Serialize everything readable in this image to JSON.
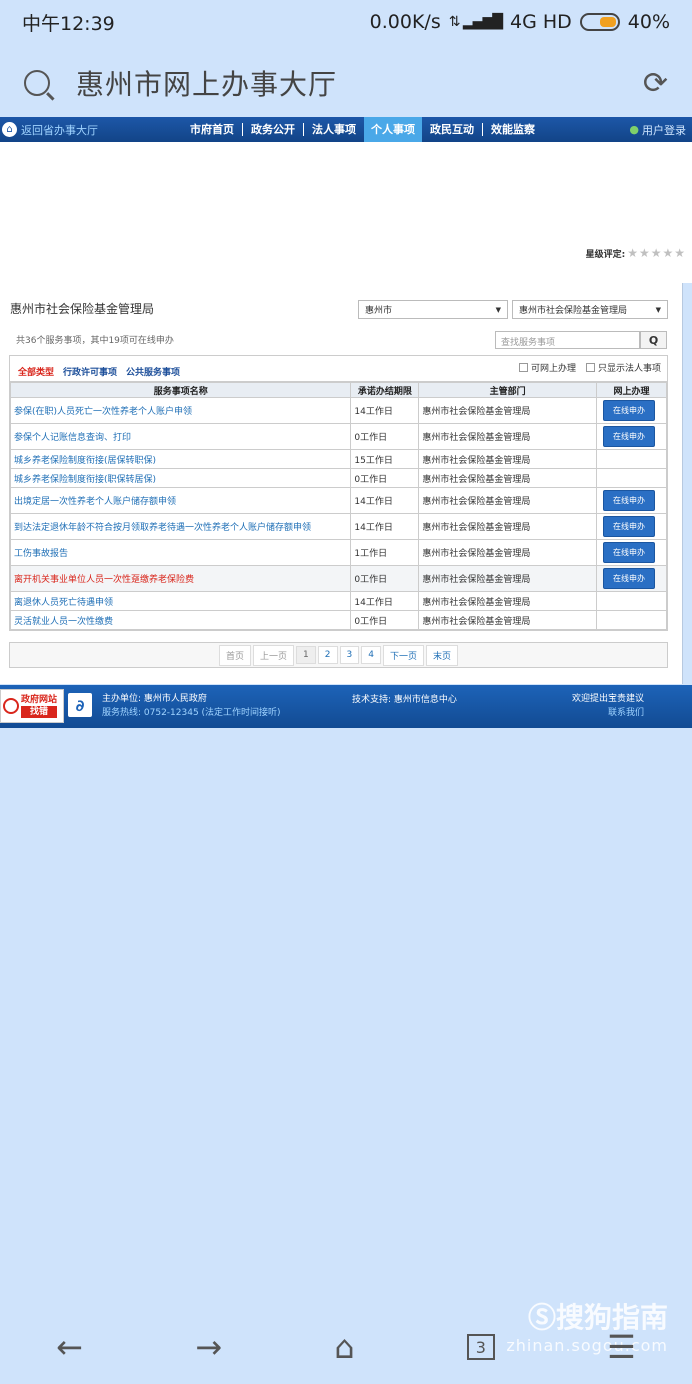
{
  "status": {
    "time": "中午12:39",
    "speed": "0.00K/s",
    "network": "4G HD",
    "battery": "40%"
  },
  "browser": {
    "title": "惠州市网上办事大厅"
  },
  "sitenav": {
    "back": "返回省办事大厅",
    "items": [
      "市府首页",
      "政务公开",
      "法人事项",
      "个人事项",
      "政民互动",
      "效能监察"
    ],
    "active_index": 3,
    "login": "用户登录"
  },
  "rating": {
    "label": "星级评定:",
    "stars": "★★★★★",
    "value": 0
  },
  "panel": {
    "dept_title": "惠州市社会保险基金管理局",
    "city_select": "惠州市",
    "dept_select": "惠州市社会保险基金管理局",
    "count_text": "共36个服务事项，其中19项可在线申办",
    "search_placeholder": "查找服务事项",
    "search_btn": "Q"
  },
  "filters": {
    "types": [
      "全部类型",
      "行政许可事项",
      "公共服务事项"
    ],
    "active": 0,
    "check_online": "可网上办理",
    "check_legal": "只显示法人事项"
  },
  "table": {
    "headers": [
      "服务事项名称",
      "承诺办结期限",
      "主管部门",
      "网上办理"
    ],
    "apply_label": "在线申办",
    "rows": [
      {
        "name": "参保(在职)人员死亡一次性养老个人账户申领",
        "limit": "14工作日",
        "dept": "惠州市社会保险基金管理局",
        "online": true,
        "tall": true,
        "red": false
      },
      {
        "name": "参保个人记账信息查询、打印",
        "limit": "0工作日",
        "dept": "惠州市社会保险基金管理局",
        "online": true,
        "tall": true,
        "red": false
      },
      {
        "name": "城乡养老保险制度衔接(居保转职保)",
        "limit": "15工作日",
        "dept": "惠州市社会保险基金管理局",
        "online": false,
        "tall": false,
        "red": false
      },
      {
        "name": "城乡养老保险制度衔接(职保转居保)",
        "limit": "0工作日",
        "dept": "惠州市社会保险基金管理局",
        "online": false,
        "tall": false,
        "red": false
      },
      {
        "name": "出境定居一次性养老个人账户储存额申领",
        "limit": "14工作日",
        "dept": "惠州市社会保险基金管理局",
        "online": true,
        "tall": true,
        "red": false
      },
      {
        "name": "到达法定退休年龄不符合按月领取养老待遇一次性养老个人账户储存额申领",
        "limit": "14工作日",
        "dept": "惠州市社会保险基金管理局",
        "online": true,
        "tall": true,
        "red": false
      },
      {
        "name": "工伤事故报告",
        "limit": "1工作日",
        "dept": "惠州市社会保险基金管理局",
        "online": true,
        "tall": true,
        "red": false
      },
      {
        "name": "离开机关事业单位人员一次性趸缴养老保险费",
        "limit": "0工作日",
        "dept": "惠州市社会保险基金管理局",
        "online": true,
        "tall": true,
        "red": true
      },
      {
        "name": "离退休人员死亡待遇申领",
        "limit": "14工作日",
        "dept": "惠州市社会保险基金管理局",
        "online": false,
        "tall": false,
        "red": false
      },
      {
        "name": "灵活就业人员一次性缴费",
        "limit": "0工作日",
        "dept": "惠州市社会保险基金管理局",
        "online": false,
        "tall": false,
        "red": false
      }
    ]
  },
  "pager": [
    "首页",
    "上一页",
    "1",
    "2",
    "3",
    "4",
    "下一页",
    "末页"
  ],
  "footer": {
    "badge_l1": "政府网站",
    "badge_l2": "找错",
    "host": "主办单位: 惠州市人民政府",
    "hotline": "服务热线: 0752-12345 (法定工作时间接听)",
    "tech": "技术支持: 惠州市信息中心",
    "suggest": "欢迎提出宝贵建议",
    "contact": "联系我们"
  },
  "bottomnav": {
    "back": "←",
    "forward": "→",
    "home": "⌂",
    "tabs_count": "3",
    "menu": "☰"
  },
  "watermark": {
    "line1": "Ⓢ搜狗指南",
    "line2": "zhinan.sogou.com"
  },
  "colors": {
    "nav_bg": "#1d57a8",
    "active_tab": "#4aa8e8",
    "link": "#1f6fb6",
    "red": "#d9261c",
    "page_bg": "#cfe3fb"
  }
}
